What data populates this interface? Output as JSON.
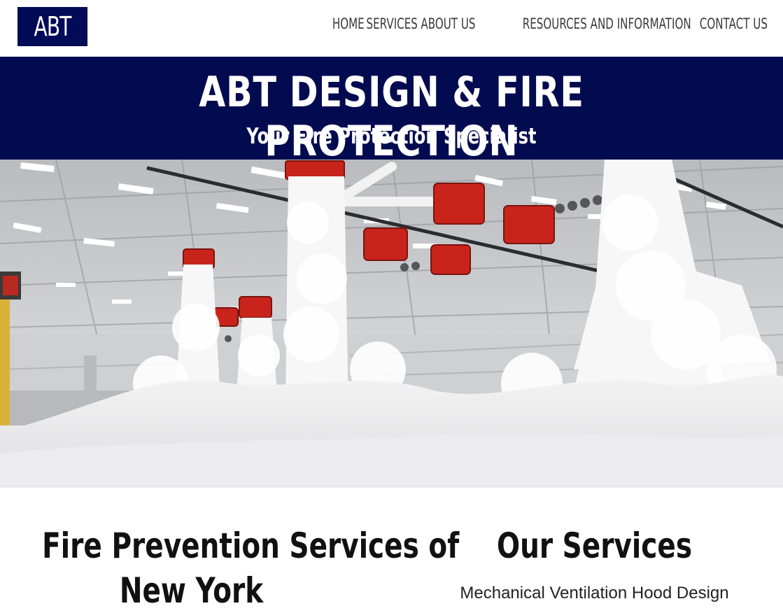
{
  "header": {
    "logo_text": "ABT",
    "nav": [
      "HOME",
      "SERVICES",
      "ABOUT US",
      "RESOURCES AND INFORMATION",
      "CONTACT US"
    ]
  },
  "banner": {
    "title": "ABT DESIGN & FIRE PROTECTION",
    "tagline": "Your Fire Protection Specialist"
  },
  "hero": {
    "image": "hangar-foam-fire-suppression-photo"
  },
  "sections": {
    "left_heading_line1": "Fire Prevention Services of",
    "left_heading_line2": "New York",
    "right_heading": "Our Services",
    "first_service": "Mechanical Ventilation Hood Design"
  },
  "colors": {
    "brand_navy": "#020b50",
    "nav_text": "#3b3b3b"
  }
}
